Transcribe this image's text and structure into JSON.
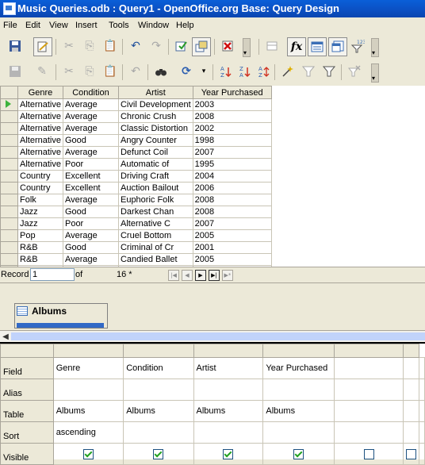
{
  "window": {
    "title": "Music Queries.odb : Query1 - OpenOffice.org Base: Query Design"
  },
  "menu": [
    "File",
    "Edit",
    "View",
    "Insert",
    "Tools",
    "Window",
    "Help"
  ],
  "toolbar1": {
    "icons": [
      "save-icon",
      "edit-mode-icon",
      "cut-icon",
      "copy-icon",
      "paste-icon",
      "undo-icon",
      "redo-icon",
      "run-query-icon",
      "toggle-design-icon",
      "clear-query-icon",
      "add-tables-icon",
      "functions-icon",
      "table-name-icon",
      "alias-icon",
      "distinct-values-icon"
    ],
    "functions_glyph": "fx",
    "distinct_badge": "123"
  },
  "toolbar2": {
    "icons": [
      "save-record-icon",
      "edit-data-icon",
      "cut-icon",
      "copy-icon",
      "paste-icon",
      "undo-icon",
      "find-record-icon",
      "refresh-icon",
      "sort-ascending-icon",
      "sort-descending-icon",
      "sort-icon",
      "autofilter-icon",
      "standard-filter-icon",
      "apply-filter-icon",
      "remove-filter-icon"
    ]
  },
  "results": {
    "columns": [
      "Genre",
      "Condition",
      "Artist",
      "Year Purchased"
    ],
    "rows": [
      [
        "Alternative",
        "Average",
        "Civil Development",
        "2003"
      ],
      [
        "Alternative",
        "Average",
        "Chronic Crush",
        "2008"
      ],
      [
        "Alternative",
        "Average",
        "Classic Distortion",
        "2002"
      ],
      [
        "Alternative",
        "Good",
        "Angry Counter",
        "1998"
      ],
      [
        "Alternative",
        "Average",
        "Defunct Coil",
        "2007"
      ],
      [
        "Alternative",
        "Poor",
        "Automatic of",
        "1995"
      ],
      [
        "Country",
        "Excellent",
        "Driving Craft",
        "2004"
      ],
      [
        "Country",
        "Excellent",
        "Auction Bailout",
        "2006"
      ],
      [
        "Folk",
        "Average",
        "Euphoric Folk",
        "2008"
      ],
      [
        "Jazz",
        "Good",
        "Darkest Chan",
        "2008"
      ],
      [
        "Jazz",
        "Poor",
        "Alternative C",
        "2007"
      ],
      [
        "Pop",
        "Average",
        "Cruel Bottom",
        "2005"
      ],
      [
        "R&B",
        "Good",
        "Criminal of Cr",
        "2001"
      ],
      [
        "R&B",
        "Average",
        "Candied Ballet",
        "2005"
      ]
    ]
  },
  "record_bar": {
    "label": "Record",
    "value": "1",
    "of_label": "of",
    "total": "16 *"
  },
  "design": {
    "table_name": "Albums"
  },
  "qbe": {
    "row_labels": [
      "Field",
      "Alias",
      "Table",
      "Sort",
      "Visible"
    ],
    "columns": [
      {
        "field": "Genre",
        "alias": "",
        "table": "Albums",
        "sort": "ascending",
        "visible": true
      },
      {
        "field": "Condition",
        "alias": "",
        "table": "Albums",
        "sort": "",
        "visible": true
      },
      {
        "field": "Artist",
        "alias": "",
        "table": "Albums",
        "sort": "",
        "visible": true
      },
      {
        "field": "Year Purchased",
        "alias": "",
        "table": "Albums",
        "sort": "",
        "visible": true
      },
      {
        "field": "",
        "alias": "",
        "table": "",
        "sort": "",
        "visible": false
      },
      {
        "field": "",
        "alias": "",
        "table": "",
        "sort": "",
        "visible": false
      }
    ]
  }
}
